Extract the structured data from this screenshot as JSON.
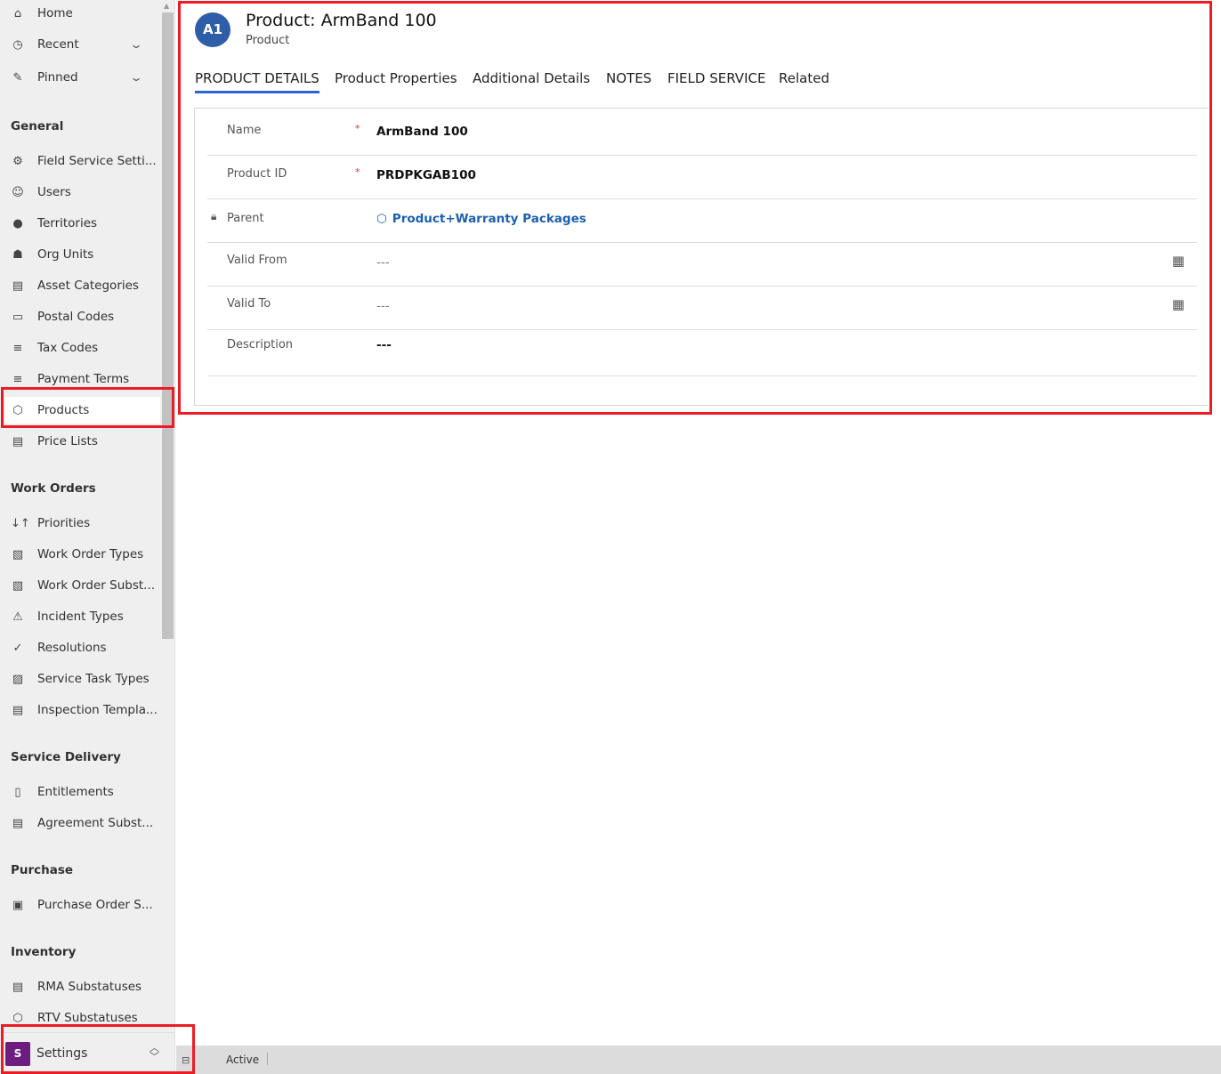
{
  "sidebar": {
    "top": [
      {
        "label": "Home",
        "icon": "home-icon"
      },
      {
        "label": "Recent",
        "icon": "clock-icon"
      },
      {
        "label": "Pinned",
        "icon": "pin-icon"
      }
    ],
    "groups": [
      {
        "label": "General",
        "items": [
          {
            "label": "Field Service Setti...",
            "icon": "gear-icon"
          },
          {
            "label": "Users",
            "icon": "user-icon"
          },
          {
            "label": "Territories",
            "icon": "globe-icon"
          },
          {
            "label": "Org Units",
            "icon": "org-chart-icon"
          },
          {
            "label": "Asset Categories",
            "icon": "asset-icon"
          },
          {
            "label": "Postal Codes",
            "icon": "postal-icon"
          },
          {
            "label": "Tax Codes",
            "icon": "database-icon"
          },
          {
            "label": "Payment Terms",
            "icon": "database-icon"
          },
          {
            "label": "Products",
            "icon": "box-icon",
            "selected": true
          },
          {
            "label": "Price Lists",
            "icon": "document-icon"
          }
        ]
      },
      {
        "label": "Work Orders",
        "items": [
          {
            "label": "Priorities",
            "icon": "sort-icon"
          },
          {
            "label": "Work Order Types",
            "icon": "clipboard-icon"
          },
          {
            "label": "Work Order Subst...",
            "icon": "clipboard-icon"
          },
          {
            "label": "Incident Types",
            "icon": "warning-icon"
          },
          {
            "label": "Resolutions",
            "icon": "check-circle-icon"
          },
          {
            "label": "Service Task Types",
            "icon": "task-icon"
          },
          {
            "label": "Inspection Templa...",
            "icon": "document-icon"
          }
        ]
      },
      {
        "label": "Service Delivery",
        "items": [
          {
            "label": "Entitlements",
            "icon": "entitlement-icon"
          },
          {
            "label": "Agreement Subst...",
            "icon": "document-icon"
          }
        ]
      },
      {
        "label": "Purchase",
        "items": [
          {
            "label": "Purchase Order S...",
            "icon": "purchase-icon"
          }
        ]
      },
      {
        "label": "Inventory",
        "items": [
          {
            "label": "RMA Substatuses",
            "icon": "document-icon"
          },
          {
            "label": "RTV Substatuses",
            "icon": "box-return-icon"
          }
        ]
      }
    ],
    "area": {
      "initial": "S",
      "label": "Settings",
      "color": "#6b1e7f"
    }
  },
  "header": {
    "avatar": "A1",
    "title": "Product: ArmBand 100",
    "subtitle": "Product"
  },
  "tabs": [
    {
      "label": "PRODUCT DETAILS",
      "active": true
    },
    {
      "label": "Product Properties"
    },
    {
      "label": "Additional Details"
    },
    {
      "label": "NOTES"
    },
    {
      "label": "FIELD SERVICE"
    },
    {
      "label": "Related"
    }
  ],
  "form": {
    "fields": [
      {
        "label": "Name",
        "required": "*",
        "value": "ArmBand 100"
      },
      {
        "label": "Product ID",
        "required": "*",
        "value": "PRDPKGAB100"
      },
      {
        "label": "Parent",
        "value": "Product+Warranty Packages"
      },
      {
        "label": "Valid From",
        "value": "---"
      },
      {
        "label": "Valid To",
        "value": "---"
      },
      {
        "label": "Description",
        "value": "---"
      }
    ]
  },
  "status": {
    "text": "Active"
  },
  "colors": {
    "accent": "#2b66d9",
    "link": "#1b5fb4",
    "highlight": "#ed1c24"
  }
}
